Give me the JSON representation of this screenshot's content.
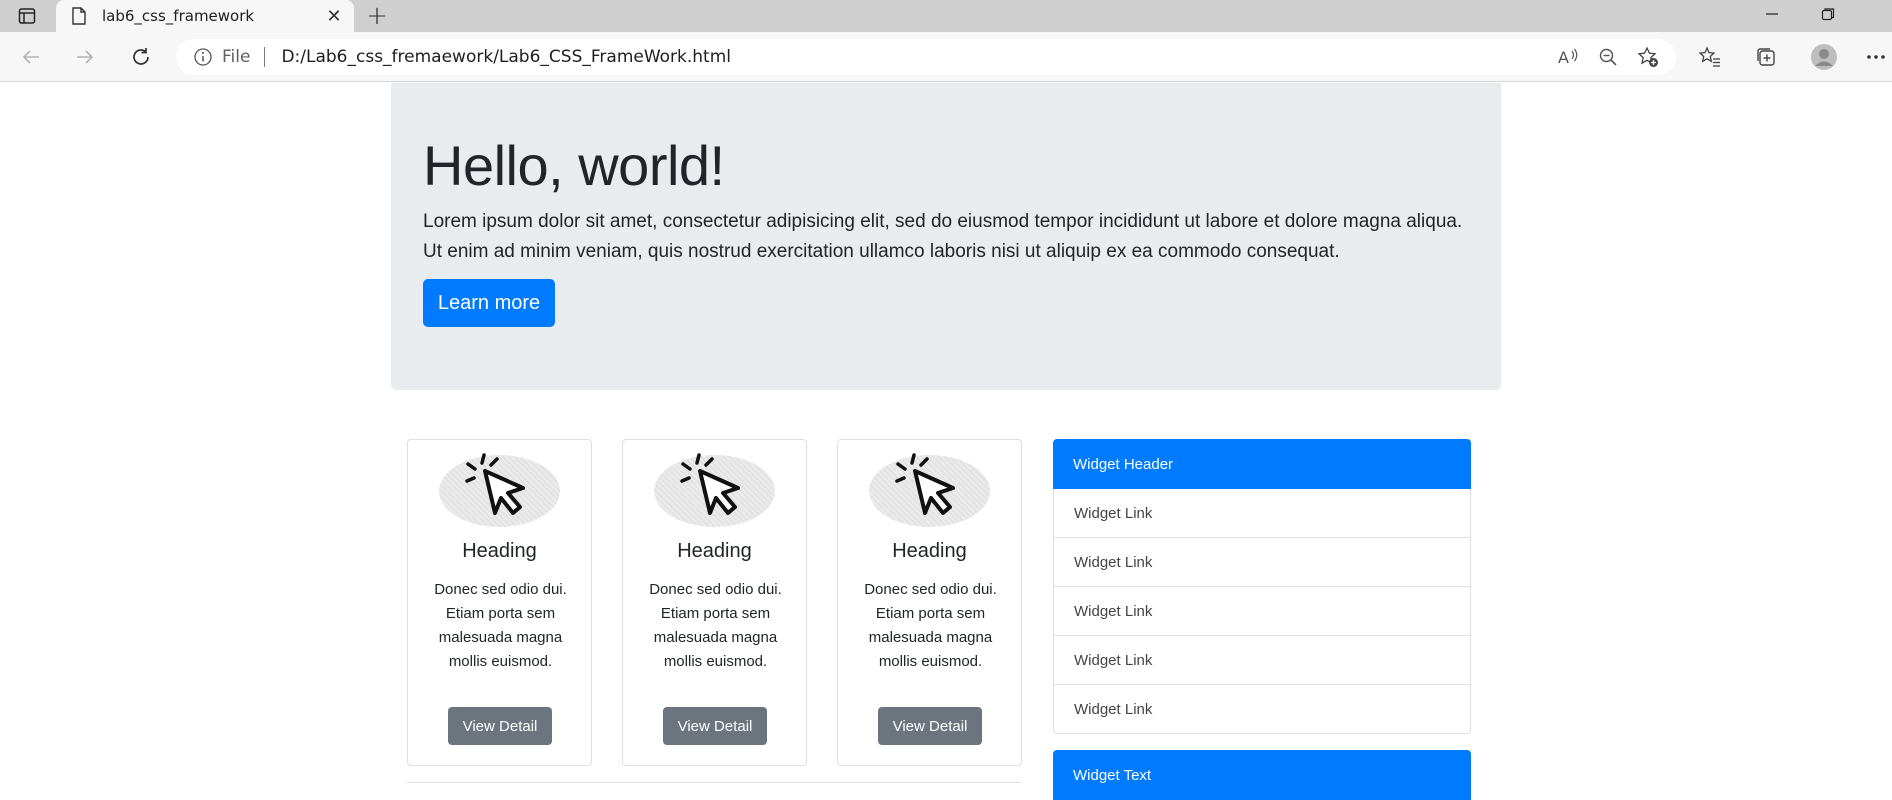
{
  "browser": {
    "tab_title": "lab6_css_framework",
    "new_tab_label": "+",
    "close_label": "✕",
    "address_scheme": "File",
    "address_url": "D:/Lab6_css_fremaework/Lab6_CSS_FrameWork.html"
  },
  "jumbotron": {
    "title": "Hello, world!",
    "text": "Lorem ipsum dolor sit amet, consectetur adipisicing elit, sed do eiusmod tempor incididunt ut labore et dolore magna aliqua. Ut enim ad minim veniam, quis nostrud exercitation ullamco laboris nisi ut aliquip ex ea commodo consequat.",
    "button_label": "Learn more"
  },
  "cards": [
    {
      "heading": "Heading",
      "text": "Donec sed odio dui. Etiam porta sem malesuada magna mollis euismod.",
      "button_label": "View Detail",
      "icon": "cursor-click-icon"
    },
    {
      "heading": "Heading",
      "text": "Donec sed odio dui. Etiam porta sem malesuada magna mollis euismod.",
      "button_label": "View Detail",
      "icon": "cursor-click-icon"
    },
    {
      "heading": "Heading",
      "text": "Donec sed odio dui. Etiam porta sem malesuada magna mollis euismod.",
      "button_label": "View Detail",
      "icon": "cursor-click-icon"
    }
  ],
  "widget": {
    "header": "Widget Header",
    "links": [
      "Widget Link",
      "Widget Link",
      "Widget Link",
      "Widget Link",
      "Widget Link"
    ],
    "text_header": "Widget Text"
  },
  "colors": {
    "primary": "#007bff",
    "secondary": "#6c757d",
    "jumbotron_bg": "#e9ecef"
  }
}
